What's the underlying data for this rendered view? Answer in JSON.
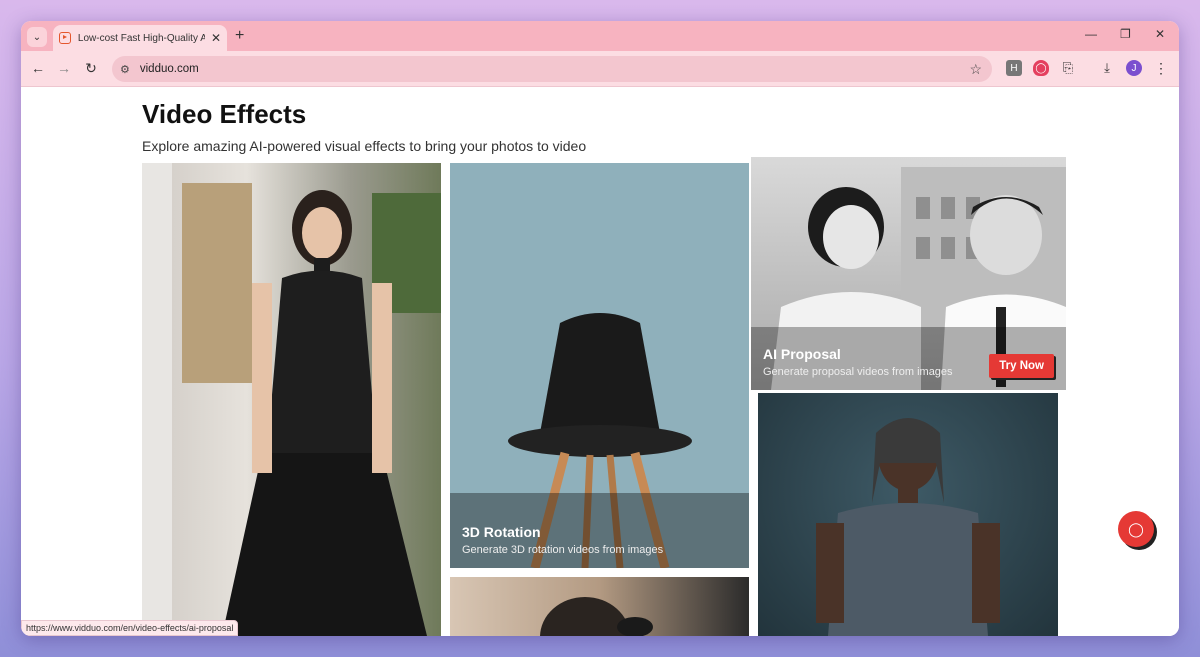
{
  "browser": {
    "tab_title": "Low-cost Fast High-Quality AI P",
    "url": "vidduo.com",
    "status_url": "https://www.vidduo.com/en/video-effects/ai-proposal",
    "profile_initial": "J",
    "ext_h": "H"
  },
  "page": {
    "heading": "Video Effects",
    "subheading": "Explore amazing AI-powered visual effects to bring your photos to video"
  },
  "cards": [
    {
      "title": "",
      "desc": ""
    },
    {
      "title": "3D Rotation",
      "desc": "Generate 3D rotation videos from images"
    },
    {
      "title": "AI Proposal",
      "desc": "Generate proposal videos from images",
      "button": "Try Now"
    },
    {
      "title": "",
      "desc": ""
    },
    {
      "title": "",
      "desc": ""
    }
  ],
  "colors": {
    "accent": "#e53935",
    "tab_bar": "#f7b3c0"
  },
  "icons": [
    "tab-search-icon",
    "close-icon",
    "plus-icon",
    "minimize-icon",
    "restore-icon",
    "back-icon",
    "forward-icon",
    "reload-icon",
    "site-info-icon",
    "star-icon",
    "extensions-icon",
    "download-icon",
    "menu-icon",
    "chat-icon"
  ]
}
